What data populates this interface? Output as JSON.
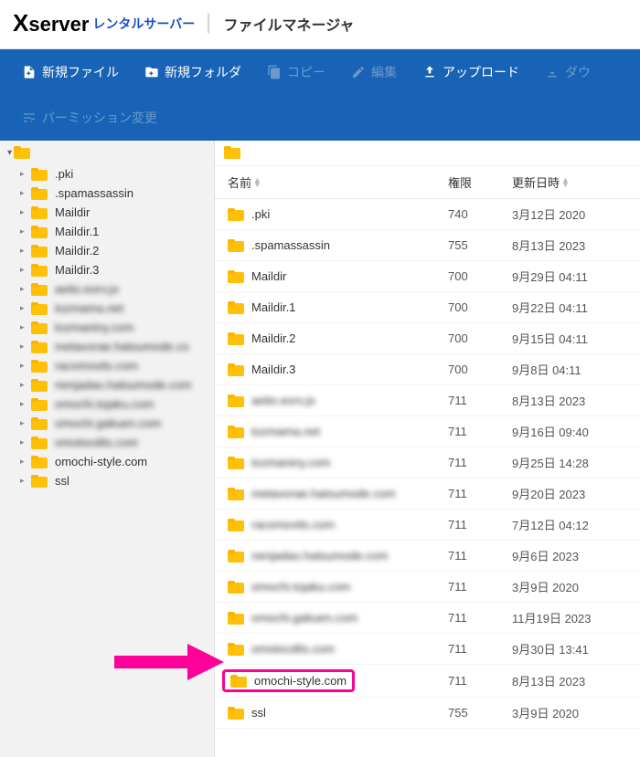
{
  "header": {
    "logo": "Xserver",
    "sub1": "レンタルサーバー",
    "sub2": "ファイルマネージャ"
  },
  "toolbar": {
    "new_file": "新規ファイル",
    "new_folder": "新規フォルダ",
    "copy": "コピー",
    "edit": "編集",
    "upload": "アップロード",
    "download": "ダウ",
    "permission": "パーミッション変更"
  },
  "sidebar": {
    "items": [
      {
        "label": ".pki",
        "blur": false
      },
      {
        "label": ".spamassassin",
        "blur": false
      },
      {
        "label": "Maildir",
        "blur": false
      },
      {
        "label": "Maildir.1",
        "blur": false
      },
      {
        "label": "Maildir.2",
        "blur": false
      },
      {
        "label": "Maildir.3",
        "blur": false
      },
      {
        "label": "aeito.eorv.jo",
        "blur": true
      },
      {
        "label": "tozmama.net",
        "blur": true
      },
      {
        "label": "tozmaniny.com",
        "blur": true
      },
      {
        "label": "metavorae.hatsumode.co",
        "blur": true
      },
      {
        "label": "racomovits.com",
        "blur": true
      },
      {
        "label": "nenjadao.hatsumode.com",
        "blur": true
      },
      {
        "label": "omochi.tojaku.com",
        "blur": true
      },
      {
        "label": "omochi.gakuen.com",
        "blur": true
      },
      {
        "label": "omotocdits.com",
        "blur": true
      },
      {
        "label": "omochi-style.com",
        "blur": false
      },
      {
        "label": "ssl",
        "blur": false
      }
    ]
  },
  "columns": {
    "name": "名前",
    "perm": "権限",
    "date": "更新日時"
  },
  "files": [
    {
      "name": ".pki",
      "perm": "740",
      "date": "3月12日 2020",
      "blur": false,
      "hl": false
    },
    {
      "name": ".spamassassin",
      "perm": "755",
      "date": "8月13日 2023",
      "blur": false,
      "hl": false
    },
    {
      "name": "Maildir",
      "perm": "700",
      "date": "9月29日 04:11",
      "blur": false,
      "hl": false
    },
    {
      "name": "Maildir.1",
      "perm": "700",
      "date": "9月22日 04:11",
      "blur": false,
      "hl": false
    },
    {
      "name": "Maildir.2",
      "perm": "700",
      "date": "9月15日 04:11",
      "blur": false,
      "hl": false
    },
    {
      "name": "Maildir.3",
      "perm": "700",
      "date": "9月8日 04:11",
      "blur": false,
      "hl": false
    },
    {
      "name": "aeito.eorv.jo",
      "perm": "711",
      "date": "8月13日 2023",
      "blur": true,
      "hl": false
    },
    {
      "name": "tozmama.net",
      "perm": "711",
      "date": "9月16日 09:40",
      "blur": true,
      "hl": false
    },
    {
      "name": "tozmaniny.com",
      "perm": "711",
      "date": "9月25日 14:28",
      "blur": true,
      "hl": false
    },
    {
      "name": "metavorae.hatsumode.com",
      "perm": "711",
      "date": "9月20日 2023",
      "blur": true,
      "hl": false
    },
    {
      "name": "racomovits.com",
      "perm": "711",
      "date": "7月12日 04:12",
      "blur": true,
      "hl": false
    },
    {
      "name": "nenjadao.hatsumode.com",
      "perm": "711",
      "date": "9月6日 2023",
      "blur": true,
      "hl": false
    },
    {
      "name": "omochi.tojaku.com",
      "perm": "711",
      "date": "3月9日 2020",
      "blur": true,
      "hl": false
    },
    {
      "name": "omochi.gakuen.com",
      "perm": "711",
      "date": "11月19日 2023",
      "blur": true,
      "hl": false
    },
    {
      "name": "omotocdits.com",
      "perm": "711",
      "date": "9月30日 13:41",
      "blur": true,
      "hl": false
    },
    {
      "name": "omochi-style.com",
      "perm": "711",
      "date": "8月13日 2023",
      "blur": false,
      "hl": true
    },
    {
      "name": "ssl",
      "perm": "755",
      "date": "3月9日 2020",
      "blur": false,
      "hl": false
    }
  ]
}
